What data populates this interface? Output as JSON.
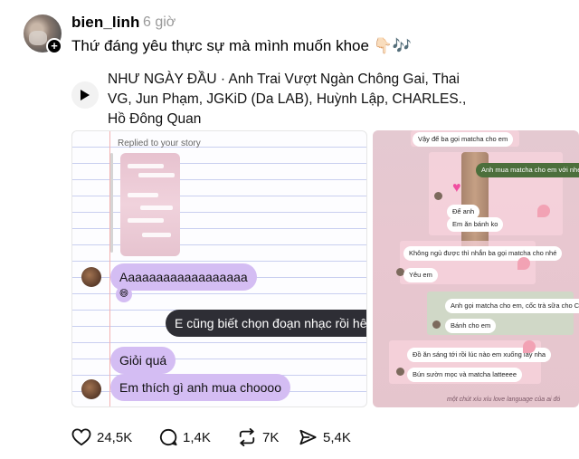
{
  "post": {
    "username": "bien_linh",
    "time": "6 giờ",
    "caption": "Thứ đáng yêu thực sự mà mình muốn khoe 👇🏻🎶",
    "music": "NHƯ NGÀY ĐẦU · Anh Trai Vượt Ngàn Chông Gai, Thai VG, Jun Phạm, JGKiD (Da LAB), Huỳnh Lập, CHARLES., Hồ Đông Quan"
  },
  "image1": {
    "replied": "Replied to your story",
    "messages": [
      {
        "text": "Aaaaaaaaaaaaaaaaaa",
        "side": "left"
      },
      {
        "text": "E cũng biết chọn đoạn nhạc rồi hê hê",
        "side": "right"
      },
      {
        "text": "Giỏi quá",
        "side": "left"
      },
      {
        "text": "Em thích gì anh mua choooo",
        "side": "left"
      }
    ],
    "emoji": "😄"
  },
  "image2": {
    "chips": [
      "Vậy để ba gọi matcha cho em",
      "Anh mua matcha cho em với nhé",
      "Để anh",
      "Em ăn bánh ko",
      "Không ngủ được thì nhắn ba gọi matcha cho nhé",
      "Yêu em",
      "Anh gọi matcha cho em, cốc trà sữa cho Cò",
      "Bánh cho em",
      "Đồ ăn sáng tới rồi lúc nào em xuống lấy nha",
      "Bún sườn mọc và matcha latteeee"
    ],
    "footer": "một chút xíu xíu love language của ai đó"
  },
  "actions": {
    "likes": "24,5K",
    "comments": "1,4K",
    "reposts": "7K",
    "shares": "5,4K"
  }
}
